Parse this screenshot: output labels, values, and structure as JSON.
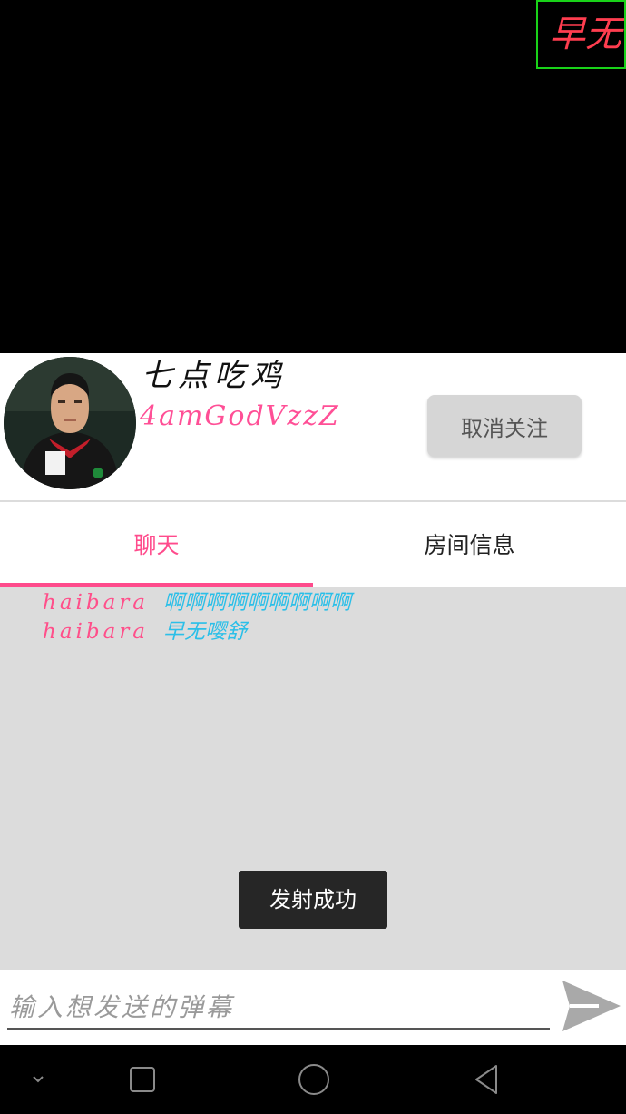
{
  "video": {
    "flying_danmaku": "早无"
  },
  "streamer": {
    "name": "七点吃鸡",
    "id": "4amGodVzzZ",
    "unfollow_label": "取消关注"
  },
  "tabs": [
    {
      "label": "聊天",
      "active": true
    },
    {
      "label": "房间信息",
      "active": false
    }
  ],
  "chat": {
    "messages": [
      {
        "user": "haibara",
        "text": "啊啊啊啊啊啊啊啊啊"
      },
      {
        "user": "haibara",
        "text": "早无嘤舒"
      }
    ]
  },
  "toast": "发射成功",
  "input": {
    "placeholder": "输入想发送的弹幕",
    "value": ""
  },
  "colors": {
    "accent": "#ff4b8c",
    "chat_text": "#2bbfe8",
    "danmaku_border": "#19d219",
    "danmaku_text": "#ff3d4f"
  },
  "icons": {
    "send": "send-icon",
    "nav": [
      "chevron-down-icon",
      "square-icon",
      "circle-icon",
      "back-triangle-icon"
    ]
  }
}
